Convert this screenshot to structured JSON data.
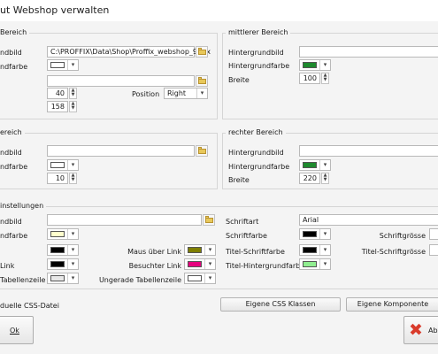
{
  "window": {
    "title": "ut Webshop verwalten"
  },
  "left_top": {
    "title": "Bereich",
    "hintergrundbild_label": "ndbild",
    "hintergrundbild_value": "C:\\PROFFIX\\Data\\Shop\\Proffix_webshop_990x",
    "hintergrundfarbe_label": "ndfarbe",
    "hintergrundfarbe_color": "#ffffff",
    "width_value": "40",
    "position_label": "Position",
    "position_value": "Right",
    "height_value": "158"
  },
  "middle": {
    "title": "mittlerer Bereich",
    "hintergrundbild_label": "Hintergrundbild",
    "hintergrundfarbe_label": "Hintergrundfarbe",
    "hintergrundfarbe_color": "#1e8a2e",
    "breite_label": "Breite",
    "breite_value": "100"
  },
  "left_bottom": {
    "title": "ereich",
    "hintergrundbild_label": "ndbild",
    "hintergrundfarbe_label": "ndfarbe",
    "hintergrundfarbe_color": "#ffffff",
    "value": "10"
  },
  "right": {
    "title": "rechter Bereich",
    "hintergrundbild_label": "Hintergrundbild",
    "hintergrundfarbe_label": "Hintergrundfarbe",
    "hintergrundfarbe_color": "#1e8a2e",
    "breite_label": "Breite",
    "breite_value": "220"
  },
  "settings": {
    "title": "instellungen",
    "hintergrundbild_label": "ndbild",
    "hintergrundfarbe_label": "ndfarbe",
    "hintergrundfarbe_color": "#ffffcc",
    "link_label": "Link",
    "tabellenzeile_label": "Tabellenzeile",
    "text_color": "#000000",
    "link_color": "#000000",
    "tabellenzeile_color": "#e8e8e8",
    "maus_label": "Maus über Link",
    "maus_color": "#7f7f00",
    "besuchter_label": "Besuchter Link",
    "besuchter_color": "#e6007e",
    "ungerade_label": "Ungerade Tabellenzeile",
    "ungerade_color": "#ffffff",
    "schriftart_label": "Schriftart",
    "schriftart_value": "Arial",
    "schriftfarbe_label": "Schriftfarbe",
    "schriftfarbe_color": "#000000",
    "titel_schriftfarbe_label": "Titel-Schriftfarbe",
    "titel_schriftfarbe_color": "#000000",
    "titel_hintergrundfarbe_label": "Titel-Hintergrundfarbe",
    "titel_hintergrundfarbe_color": "#90ee90",
    "schriftgroesse_label": "Schriftgrösse",
    "titel_schriftgroesse_label": "Titel-Schriftgrösse"
  },
  "css_file_label": "duelle CSS-Datei",
  "buttons": {
    "css_klassen": "Eigene CSS Klassen",
    "komponente": "Eigene Komponente",
    "ok": "Ok",
    "abbrechen": "Ab"
  }
}
